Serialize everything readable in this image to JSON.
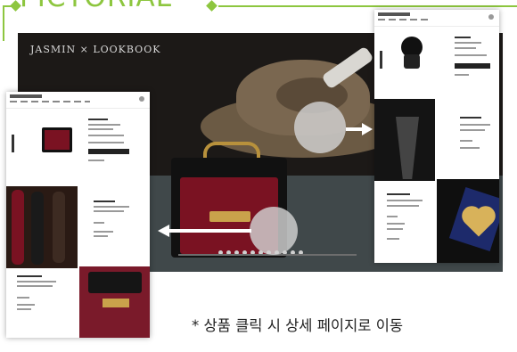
{
  "header": {
    "title": "PICTORIAL",
    "accent_color": "#8dc63f"
  },
  "hero": {
    "brand": "JASMIN × LOOKBOOK",
    "slide_count": 11
  },
  "caption": {
    "text": "* 상품 클릭 시 상세 페이지로 이동"
  },
  "indicators": {
    "touch_icon": "tap-circle-icon",
    "arrow_right_icon": "arrow-right-icon",
    "arrow_left_icon": "arrow-left-icon"
  }
}
